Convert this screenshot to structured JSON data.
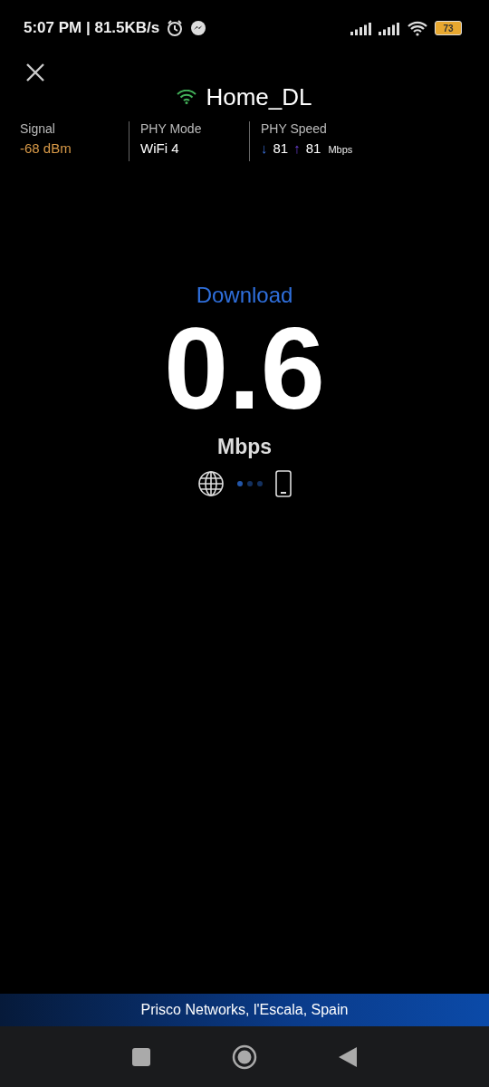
{
  "status_bar": {
    "time": "5:07 PM | 81.5KB/s",
    "battery": "73"
  },
  "header": {
    "network_name": "Home_DL"
  },
  "stats": [
    {
      "label": "Signal",
      "kind": "signal",
      "value": "-68 dBm"
    },
    {
      "label": "PHY Mode",
      "kind": "text",
      "value": "WiFi 4"
    },
    {
      "label": "PHY Speed",
      "kind": "speed",
      "down_arrow": "↓",
      "down": "81",
      "up_arrow": "↑",
      "up": "81",
      "unit": "Mbps"
    }
  ],
  "test": {
    "phase": "Download",
    "value": "0.6",
    "unit": "Mbps"
  },
  "progress_dots": [
    {
      "on": true
    },
    {
      "on": false
    },
    {
      "on": false
    }
  ],
  "footer": {
    "server": "Prisco Networks, l'Escala, Spain"
  }
}
